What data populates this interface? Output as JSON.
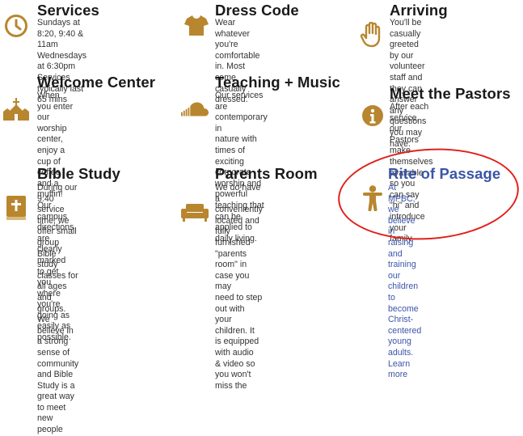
{
  "accent_color": "#b8862f",
  "link_color": "#3a55a8",
  "annotation_color": "#e0211c",
  "cards": {
    "services": {
      "title": "Services",
      "body": "Sundays at 8:20, 9:40 & 11am\nWednesdays at 6:30pm\nServices typically last 65 mins",
      "icon": "clock-icon"
    },
    "dress_code": {
      "title": "Dress Code",
      "body": "Wear whatever you're\ncomfortable in. Most come\ncasually dressed.",
      "icon": "shirt-icon"
    },
    "arriving": {
      "title": "Arriving",
      "body": "You'll be casually greeted by our\nvolunteer staff and they can\nanswer any questions you may\nhave.",
      "icon": "hand-icon"
    },
    "welcome_center": {
      "title": "Welcome Center",
      "body": "When you enter our worship\ncenter, enjoy a cup of coffee and a\nmuffin! Our campus directions are\nclearly marked to get you where\nyou're going as easily as possible.",
      "icon": "church-icon"
    },
    "teaching_music": {
      "title": "Teaching + Music",
      "body": "Our services are contemporary in\nnature with times of exciting\ncorporate worship and powerful\nteaching that can be applied to\ndaily living.",
      "icon": "soundcloud-icon"
    },
    "meet_pastors": {
      "title": "Meet the Pastors",
      "body": "After each service, our Pastors\nmake themselves available so you\ncan say \"hi\" and introduce your\nfamily.",
      "icon": "info-icon"
    },
    "bible_study": {
      "title": "Bible Study",
      "body": "During our 9:40 service time, we\noffer small group Bible study\nclasses for all ages and groups.\nWe believe in a strong sense of\ncommunity and Bible Study is a\ngreat way to meet new people",
      "icon": "bible-icon"
    },
    "parents_room": {
      "title": "Parents Room",
      "body": "We do have a conveniently\nlocated and fully furnished\n\"parents room\" in case you may\nneed to step out with your\nchildren. It is equipped with audio\n& video so you won't miss the",
      "icon": "couch-icon"
    },
    "rite_of_passage": {
      "title": "Rite of Passage",
      "body": "At MPBC, we believe in raising and\ntraining our children to become\nChrist-centered young adults.\nLearn more",
      "icon": "child-icon"
    }
  }
}
